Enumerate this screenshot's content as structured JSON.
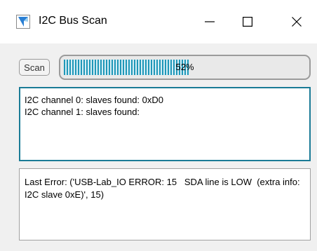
{
  "window": {
    "title": "I2C Bus Scan",
    "icon": "app-icon"
  },
  "controls": {
    "scan_label": "Scan",
    "progress_percent": 52,
    "progress_text": "52%"
  },
  "output": {
    "lines": [
      "I2C channel 0: slaves found: 0xD0",
      "I2C channel 1: slaves found:"
    ]
  },
  "error": {
    "text": "Last Error: ('USB-Lab_IO ERROR: 15   SDA line is LOW  (extra info: I2C slave 0xE)', 15)"
  },
  "colors": {
    "accent": "#1f97b8",
    "output_border": "#1a7b96"
  }
}
